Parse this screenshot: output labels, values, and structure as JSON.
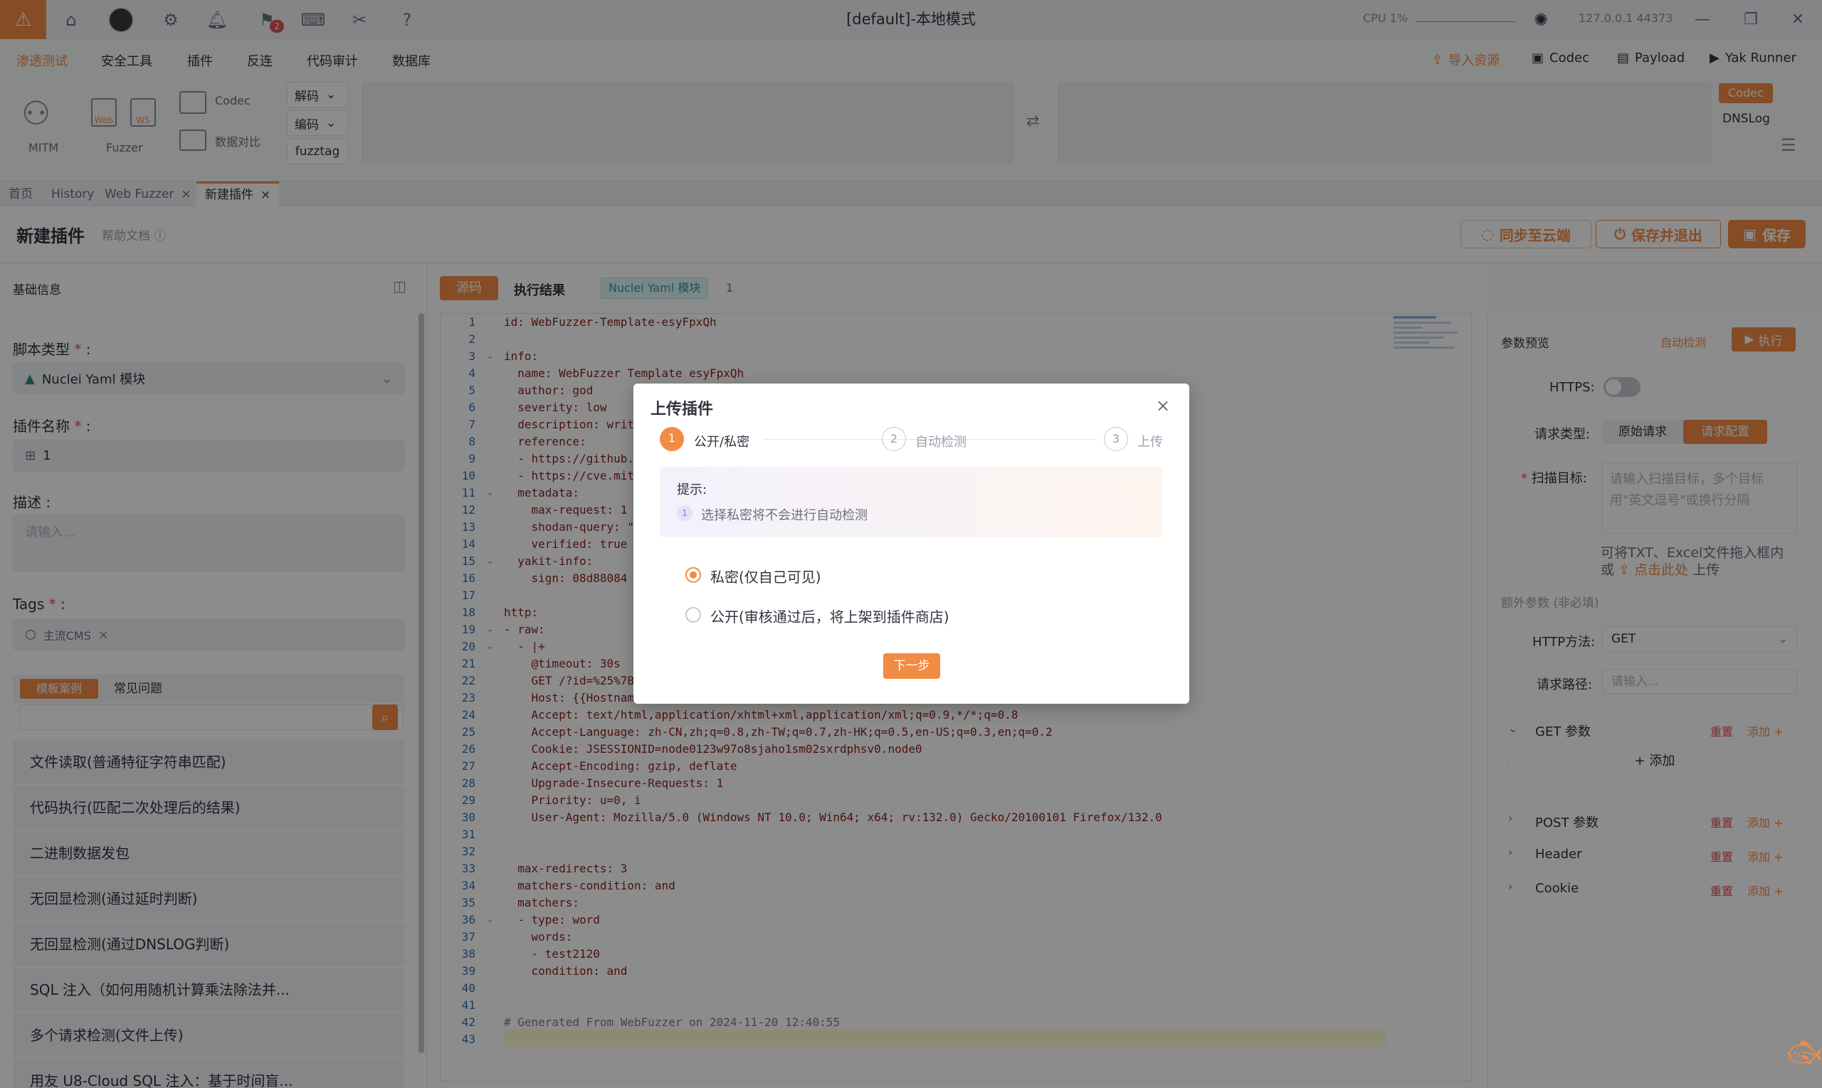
{
  "window": {
    "title": "[default]-本地模式",
    "cpu": "CPU 1%",
    "ip": "127.0.0.1 44373",
    "notification_count": "2"
  },
  "menu": {
    "items": [
      "渗透测试",
      "安全工具",
      "插件",
      "反连",
      "代码审计",
      "数据库"
    ],
    "right": [
      "导入资源",
      "Codec",
      "Payload",
      "Yak Runner"
    ]
  },
  "toolbar": {
    "mitm": "MITM",
    "fuzzer": "Fuzzer",
    "web": "Web",
    "ws": "WS",
    "codec": "Codec",
    "compare": "数据对比",
    "decode": "解码",
    "encode": "编码",
    "fuzztag": "fuzztag",
    "codec_tag": "Codec",
    "dnslog": "DNSLog"
  },
  "tabs": [
    "首页",
    "History",
    "Web Fuzzer",
    "新建插件"
  ],
  "header": {
    "title": "新建插件",
    "help": "帮助文档",
    "sync": "同步至云端",
    "save_exit": "保存并退出",
    "save": "保存"
  },
  "left": {
    "basic_info": "基础信息",
    "script_type_label": "脚本类型",
    "script_type_value": "Nuclei Yaml 模块",
    "plugin_name_label": "插件名称",
    "plugin_name_value": "1",
    "desc_label": "描述",
    "desc_placeholder": "请输入...",
    "tags_label": "Tags",
    "tag_value": "主流CMS",
    "tab_templates": "模板案例",
    "tab_faq": "常见问题",
    "templates": [
      "文件读取(普通特征字符串匹配)",
      "代码执行(匹配二次处理后的结果)",
      "二进制数据发包",
      "无回显检测(通过延时判断)",
      "无回显检测(通过DNSLOG判断)",
      "SQL 注入（如何用随机计算乘法除法并...",
      "多个请求检测(文件上传)",
      "用友 U8-Cloud SQL 注入：基于时间盲..."
    ]
  },
  "editor": {
    "tab_source": "源码",
    "tab_result": "执行结果",
    "module_tag": "Nuclei Yaml 模块",
    "module_num": "1",
    "lines": [
      "id: WebFuzzer-Template-esyFpxQh",
      "",
      "info:",
      "  name: WebFuzzer Template esyFpxQh",
      "  author: god",
      "  severity: low",
      "  description: writ",
      "  reference:",
      "  - https://github.",
      "  - https://cve.mit",
      "  metadata:",
      "    max-request: 1",
      "    shodan-query: \"",
      "    verified: true",
      "  yakit-info:",
      "    sign: 08d88084",
      "",
      "http:",
      "- raw:",
      "  - |+",
      "    @timeout: 30s",
      "    GET /?id=%25%7B",
      "    Host: {{Hostnam",
      "    Accept: text/html,application/xhtml+xml,application/xml;q=0.9,*/*;q=0.8",
      "    Accept-Language: zh-CN,zh;q=0.8,zh-TW;q=0.7,zh-HK;q=0.5,en-US;q=0.3,en;q=0.2",
      "    Cookie: JSESSIONID=node0123w97o8sjaho1sm02sxrdphsv0.node0",
      "    Accept-Encoding: gzip, deflate",
      "    Upgrade-Insecure-Requests: 1",
      "    Priority: u=0, i",
      "    User-Agent: Mozilla/5.0 (Windows NT 10.0; Win64; x64; rv:132.0) Gecko/20100101 Firefox/132.0",
      "",
      "",
      "  max-redirects: 3",
      "  matchers-condition: and",
      "  matchers:",
      "  - type: word",
      "    words:",
      "    - test2120",
      "    condition: and",
      "",
      "",
      "# Generated From WebFuzzer on 2024-11-20 12:40:55",
      ""
    ]
  },
  "right": {
    "title": "参数预览",
    "auto_detect": "自动检测",
    "run": "执行",
    "https": "HTTPS:",
    "request_type": "请求类型:",
    "raw_request": "原始请求",
    "request_config": "请求配置",
    "scan_target": "扫描目标:",
    "scan_placeholder": "请输入扫描目标，多个目标用\"英文逗号\"或换行分隔",
    "file_hint_1": "可将TXT、Excel文件拖入框内",
    "file_hint_2": "或",
    "file_hint_link": "点击此处",
    "file_hint_3": "上传",
    "extra_params": "额外参数 (非必填)",
    "http_method": "HTTP方法:",
    "http_method_value": "GET",
    "req_path": "请求路径:",
    "req_path_placeholder": "请输入...",
    "get_params": "GET 参数",
    "post_params": "POST 参数",
    "header": "Header",
    "cookie": "Cookie",
    "reset": "重置",
    "add": "添加",
    "add_btn": "添加"
  },
  "modal": {
    "title": "上传插件",
    "steps": [
      "公开/私密",
      "自动检测",
      "上传"
    ],
    "tip_title": "提示:",
    "tip_text": "选择私密将不会进行自动检测",
    "option_private": "私密(仅自己可见)",
    "option_public": "公开(审核通过后，将上架到插件商店)",
    "next": "下一步"
  },
  "colors": {
    "accent": "#f28b44",
    "danger": "#e04f4f",
    "text": "#31343f"
  }
}
